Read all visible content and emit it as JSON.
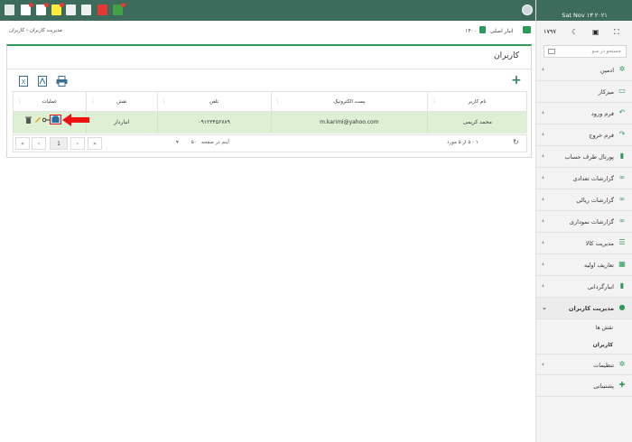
{
  "topbar": {
    "icons": [
      {
        "name": "inbox-icon",
        "color": "#ffffff"
      },
      {
        "name": "doc-alert-icon",
        "color": "#ffffff"
      },
      {
        "name": "tag-icon",
        "color": "#ffffff"
      },
      {
        "name": "docs-icon",
        "color": "#ffeb3b"
      },
      {
        "name": "list-check-icon",
        "color": "#ffffff"
      },
      {
        "name": "list-icon",
        "color": "#ffffff"
      },
      {
        "name": "note-red-icon",
        "color": "#e53935"
      },
      {
        "name": "note-green-icon",
        "color": "#43a047"
      }
    ]
  },
  "sidebar": {
    "date": "Sat Nov ۱۳ ۲۰۲۱",
    "year": "۱۷۹۷",
    "search_placeholder": "جستجو در منو",
    "items": [
      {
        "label": "ادمین",
        "icon": "gears-icon",
        "chevron": true
      },
      {
        "label": "میزکار",
        "icon": "monitor-icon",
        "chevron": false
      },
      {
        "label": "فرم ورود",
        "icon": "arrow-in-icon",
        "chevron": true
      },
      {
        "label": "فرم خروج",
        "icon": "arrow-out-icon",
        "chevron": true
      },
      {
        "label": "پورتال طرف حساب",
        "icon": "file-icon",
        "chevron": true
      },
      {
        "label": "گزارشات تعدادی",
        "icon": "link-icon",
        "chevron": true
      },
      {
        "label": "گزارشات ریالی",
        "icon": "link-icon",
        "chevron": true
      },
      {
        "label": "گزارشات نموداری",
        "icon": "link-icon",
        "chevron": true
      },
      {
        "label": "مدیریت کالا",
        "icon": "list-icon",
        "chevron": true
      },
      {
        "label": "تعاریف اولیه",
        "icon": "table-icon",
        "chevron": true
      },
      {
        "label": "انبارگردانی",
        "icon": "file-icon",
        "chevron": true
      },
      {
        "label": "مدیریت کاربران",
        "icon": "user-icon",
        "chevron": true,
        "active": true
      }
    ],
    "sub_items": [
      {
        "label": "نقش ها",
        "bold": false
      },
      {
        "label": "کاربران",
        "bold": true
      }
    ],
    "items_after": [
      {
        "label": "تنظیمات",
        "icon": "gears-icon",
        "chevron": true
      },
      {
        "label": "پشتیبانی",
        "icon": "support-icon",
        "chevron": false
      }
    ]
  },
  "breadcrumb": {
    "text": "مدیریت کاربران  ‹  کاربران",
    "store": "انبار اصلی",
    "year": "۱۴۰۰"
  },
  "card": {
    "title": "کاربران",
    "columns": [
      "نام کاربر",
      "پست الکترونیک",
      "تلفن",
      "نقش",
      "عملیات"
    ],
    "rows": [
      {
        "name": "محمد کریمی",
        "email": "m.karimi@yahoo.com",
        "phone": "۰۹۱۲۳۴۵۶۷۸۹",
        "role": "انباردار"
      }
    ],
    "pager": {
      "count_text": "۱ - ۵ از ۵ مورد",
      "per_page_value": "۵۰",
      "per_page_label": "آیتم در صفحه",
      "current_page": "1"
    }
  }
}
